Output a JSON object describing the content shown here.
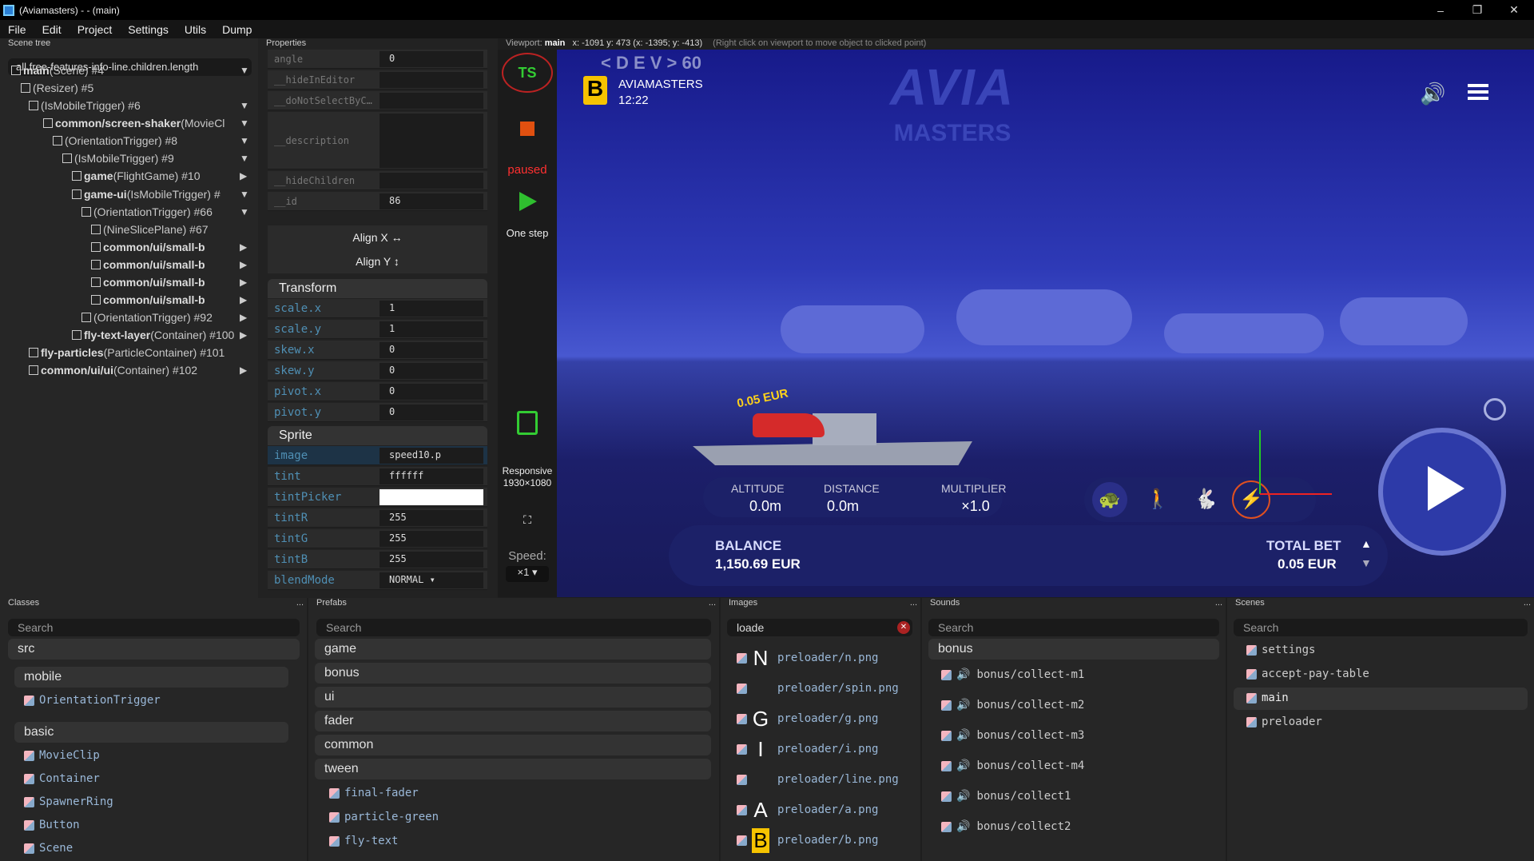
{
  "window": {
    "title": "(Aviamasters) - - (main)",
    "minimize": "–",
    "restore": "❐",
    "close": "✕"
  },
  "menu": [
    "File",
    "Edit",
    "Project",
    "Settings",
    "Utils",
    "Dump"
  ],
  "scene_tree": {
    "title": "Scene tree",
    "filter": "all.free-features-info-line.children.length",
    "nodes": [
      {
        "name": "main",
        "type": "(Scene) #4"
      },
      {
        "name": "",
        "type": "(Resizer) #5"
      },
      {
        "name": "",
        "type": "(IsMobileTrigger) #6"
      },
      {
        "name": "common/screen-shaker",
        "type": "(MovieCl"
      },
      {
        "name": "",
        "type": "(OrientationTrigger) #8"
      },
      {
        "name": "",
        "type": "(IsMobileTrigger) #9"
      },
      {
        "name": "game",
        "type": "(FlightGame) #10"
      },
      {
        "name": "game-ui",
        "type": "(IsMobileTrigger) #"
      },
      {
        "name": "",
        "type": "(OrientationTrigger) #66"
      },
      {
        "name": "",
        "type": "(NineSlicePlane) #67"
      },
      {
        "name": "common/ui/small-b",
        "type": ""
      },
      {
        "name": "common/ui/small-b",
        "type": ""
      },
      {
        "name": "common/ui/small-b",
        "type": ""
      },
      {
        "name": "common/ui/small-b",
        "type": ""
      },
      {
        "name": "",
        "type": "(OrientationTrigger) #92"
      },
      {
        "name": "fly-text-layer",
        "type": "(Container) #100"
      },
      {
        "name": "fly-particles",
        "type": "(ParticleContainer) #101"
      },
      {
        "name": "common/ui/ui",
        "type": "(Container) #102"
      }
    ]
  },
  "properties": {
    "title": "Properties",
    "top_rows": [
      {
        "k": "angle",
        "v": "0"
      },
      {
        "k": "__hideInEditor",
        "v": ""
      },
      {
        "k": "__doNotSelectByC…",
        "v": ""
      },
      {
        "k": "__description",
        "v": ""
      },
      {
        "k": "__hideChildren",
        "v": ""
      },
      {
        "k": "__id",
        "v": "86"
      }
    ],
    "align_x": "Align X ↔",
    "align_y": "Align Y ↕",
    "transform_title": "Transform",
    "transform": [
      {
        "k": "scale.x",
        "v": "1"
      },
      {
        "k": "scale.y",
        "v": "1"
      },
      {
        "k": "skew.x",
        "v": "0"
      },
      {
        "k": "skew.y",
        "v": "0"
      },
      {
        "k": "pivot.x",
        "v": "0"
      },
      {
        "k": "pivot.y",
        "v": "0"
      }
    ],
    "sprite_title": "Sprite",
    "sprite": [
      {
        "k": "image",
        "v": "speed10.p"
      },
      {
        "k": "tint",
        "v": "ffffff"
      },
      {
        "k": "tintPicker",
        "v": ""
      },
      {
        "k": "tintR",
        "v": "255"
      },
      {
        "k": "tintG",
        "v": "255"
      },
      {
        "k": "tintB",
        "v": "255"
      },
      {
        "k": "blendMode",
        "v": "NORMAL ▾"
      }
    ]
  },
  "viewport": {
    "label": "Viewport:",
    "name": "main",
    "coords": "x: -1091 y: 473 (x: -1395; y: -413)",
    "hint": "(Right click on viewport to move object to clicked point)"
  },
  "toolbar": {
    "ts": "TS",
    "paused": "paused",
    "one_step": "One step",
    "responsive": "Responsive",
    "resolution": "1930×1080",
    "speed_label": "Speed:",
    "speed_value": "×1 ▾"
  },
  "game": {
    "dev": "< D E V > 60",
    "logo_letter": "B",
    "brand": "AVIAMASTERS",
    "time": "12:22",
    "bg_logo_top": "AVIA",
    "bg_logo_bottom": "MASTERS",
    "bet_fly": "0.05 EUR",
    "altitude_label": "ALTITUDE",
    "altitude": "0.0m",
    "distance_label": "DISTANCE",
    "distance": "0.0m",
    "multiplier_label": "MULTIPLIER",
    "multiplier": "×1.0",
    "balance_label": "BALANCE",
    "balance": "1,150.69 EUR",
    "total_bet_label": "TOTAL BET",
    "total_bet": "0.05 EUR"
  },
  "classes": {
    "title": "Classes",
    "search": "Search",
    "src": "src",
    "groups": [
      {
        "name": "mobile",
        "items": [
          "OrientationTrigger"
        ]
      },
      {
        "name": "basic",
        "items": [
          "MovieClip",
          "Container",
          "SpawnerRing",
          "Button",
          "Scene"
        ]
      }
    ]
  },
  "prefabs": {
    "title": "Prefabs",
    "search": "Search",
    "groups": [
      "game",
      "bonus",
      "ui",
      "fader",
      "common",
      "tween"
    ],
    "items": [
      "final-fader",
      "particle-green",
      "fly-text"
    ]
  },
  "images": {
    "title": "Images",
    "search": "loade",
    "items": [
      {
        "g": "N",
        "f": "preloader/n.png"
      },
      {
        "g": "",
        "f": "preloader/spin.png"
      },
      {
        "g": "G",
        "f": "preloader/g.png"
      },
      {
        "g": "I",
        "f": "preloader/i.png"
      },
      {
        "g": "",
        "f": "preloader/line.png"
      },
      {
        "g": "A",
        "f": "preloader/a.png"
      },
      {
        "g": "B",
        "f": "preloader/b.png"
      }
    ]
  },
  "sounds": {
    "title": "Sounds",
    "search": "Search",
    "group": "bonus",
    "items": [
      "bonus/collect-m1",
      "bonus/collect-m2",
      "bonus/collect-m3",
      "bonus/collect-m4",
      "bonus/collect1",
      "bonus/collect2"
    ]
  },
  "scenes": {
    "title": "Scenes",
    "search": "Search",
    "items": [
      "settings",
      "accept-pay-table",
      "main",
      "preloader"
    ]
  },
  "colors": {
    "accent": "#4f8fb4",
    "play_green": "#2fbf2f",
    "stop_red": "#e05010",
    "paused_red": "#ff3030"
  }
}
